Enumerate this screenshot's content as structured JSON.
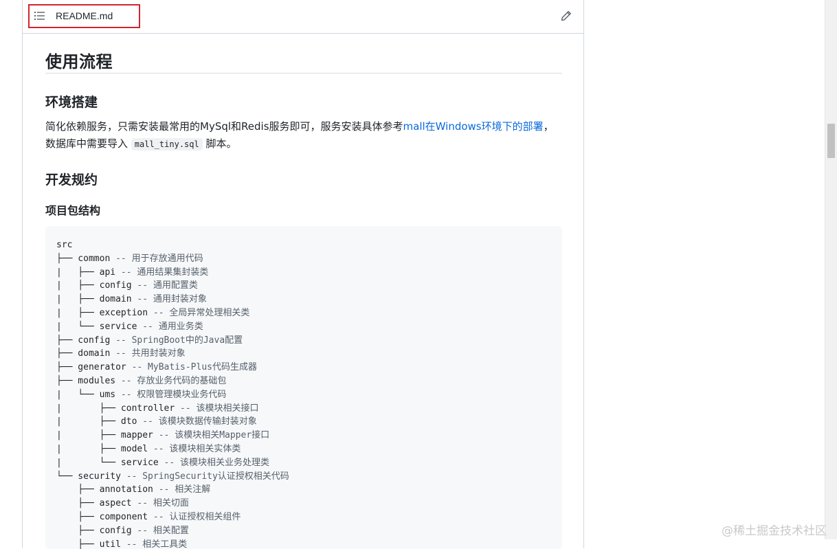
{
  "file": {
    "name": "README.md"
  },
  "readme": {
    "h1": "使用流程",
    "h2_env": "环境搭建",
    "para": {
      "prefix": "简化依赖服务，只需安装最常用的MySql和Redis服务即可，服务安装具体参考",
      "link": "mall在Windows环境下的部署",
      "mid": "， 数据库中需要导入",
      "code": "mall_tiny.sql",
      "suffix": "脚本。"
    },
    "h2_dev": "开发规约",
    "h3_pkg": "项目包结构",
    "code_lines": [
      {
        "t": "src",
        "c": ""
      },
      {
        "t": "├── common ",
        "c": "-- 用于存放通用代码"
      },
      {
        "t": "|   ├── api ",
        "c": "-- 通用结果集封装类"
      },
      {
        "t": "|   ├── config ",
        "c": "-- 通用配置类"
      },
      {
        "t": "|   ├── domain ",
        "c": "-- 通用封装对象"
      },
      {
        "t": "|   ├── exception ",
        "c": "-- 全局异常处理相关类"
      },
      {
        "t": "|   └── service ",
        "c": "-- 通用业务类"
      },
      {
        "t": "├── config ",
        "c": "-- SpringBoot中的Java配置"
      },
      {
        "t": "├── domain ",
        "c": "-- 共用封装对象"
      },
      {
        "t": "├── generator ",
        "c": "-- MyBatis-Plus代码生成器"
      },
      {
        "t": "├── modules ",
        "c": "-- 存放业务代码的基础包"
      },
      {
        "t": "|   └── ums ",
        "c": "-- 权限管理模块业务代码"
      },
      {
        "t": "|       ├── controller ",
        "c": "-- 该模块相关接口"
      },
      {
        "t": "|       ├── dto ",
        "c": "-- 该模块数据传输封装对象"
      },
      {
        "t": "|       ├── mapper ",
        "c": "-- 该模块相关Mapper接口"
      },
      {
        "t": "|       ├── model ",
        "c": "-- 该模块相关实体类"
      },
      {
        "t": "|       └── service ",
        "c": "-- 该模块相关业务处理类"
      },
      {
        "t": "└── security ",
        "c": "-- SpringSecurity认证授权相关代码"
      },
      {
        "t": "    ├── annotation ",
        "c": "-- 相关注解"
      },
      {
        "t": "    ├── aspect ",
        "c": "-- 相关切面"
      },
      {
        "t": "    ├── component ",
        "c": "-- 认证授权相关组件"
      },
      {
        "t": "    ├── config ",
        "c": "-- 相关配置"
      },
      {
        "t": "    ├── util ",
        "c": "-- 相关工具类"
      }
    ]
  },
  "watermark": "@稀土掘金技术社区",
  "icons": {
    "list": "list-icon",
    "edit": "pencil-icon"
  }
}
